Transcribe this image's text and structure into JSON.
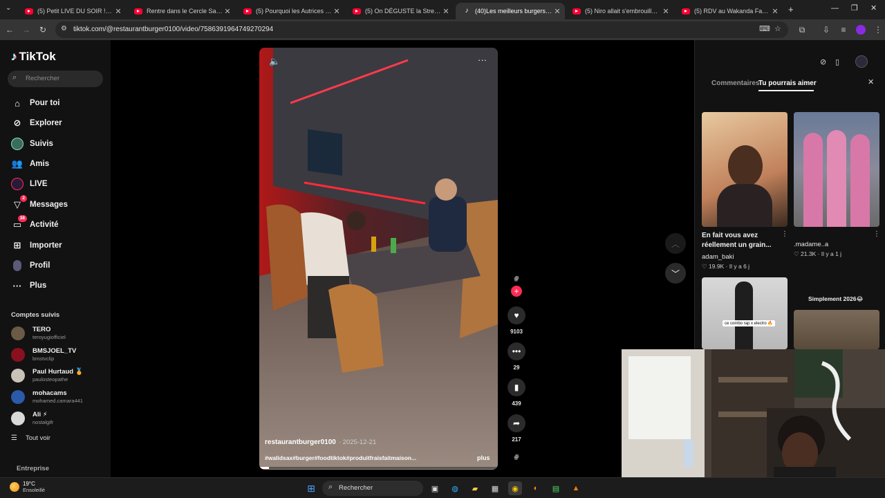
{
  "browser": {
    "tabs": [
      {
        "label": "(5) Petit LIVE DU SOIR ! - YouTu",
        "icon": "youtube-icon",
        "active": false
      },
      {
        "label": "Rentre dans le Cercle Saison 4 ;",
        "icon": "youtube-icon",
        "active": false
      },
      {
        "label": "(5) Pourquoi les Autrices gagne",
        "icon": "youtube-icon",
        "active": false
      },
      {
        "label": "(5) On DÉGUSTE la Street Food",
        "icon": "youtube-icon",
        "active": false
      },
      {
        "label": "(40)Les meilleurs burgers à Par",
        "icon": "tiktok-icon",
        "active": true
      },
      {
        "label": "(5) Niro allait s'embrouiller ave",
        "icon": "youtube-icon",
        "active": false
      },
      {
        "label": "(5) RDV au Wakanda Factory 😍",
        "icon": "youtube-icon",
        "active": false
      }
    ],
    "new_tab": "+",
    "url": "tiktok.com/@restaurantburger0100/video/7586391964749270294"
  },
  "tiktok": {
    "logo": "TikTok",
    "search_placeholder": "Rechercher",
    "nav": [
      {
        "label": "Pour toi",
        "icon": "home-icon"
      },
      {
        "label": "Explorer",
        "icon": "compass-icon"
      },
      {
        "label": "Suivis",
        "icon": "following-avatar-icon"
      },
      {
        "label": "Amis",
        "icon": "friends-icon"
      },
      {
        "label": "LIVE",
        "icon": "live-icon"
      },
      {
        "label": "Messages",
        "icon": "messages-icon",
        "badge": "2"
      },
      {
        "label": "Activité",
        "icon": "activity-icon",
        "badge": "38"
      },
      {
        "label": "Importer",
        "icon": "upload-icon"
      },
      {
        "label": "Profil",
        "icon": "profile-icon"
      },
      {
        "label": "Plus",
        "icon": "more-icon"
      }
    ],
    "following_title": "Comptes suivis",
    "following": [
      {
        "name": "TERO",
        "handle": "teroyugiofficiel",
        "color": "#6b5a45"
      },
      {
        "name": "BMSJOEL_TV",
        "handle": "bmstvclip",
        "color": "#8a1020"
      },
      {
        "name": "Paul Hurtaud 🏅",
        "handle": "paulosteopathe",
        "color": "#c9c2b8"
      },
      {
        "name": "mohacams",
        "handle": "mohamed.camara441",
        "color": "#2a5aa8"
      },
      {
        "name": "Ali ⚡",
        "handle": "nostalgifr",
        "color": "#d9d9d9"
      }
    ],
    "see_all": "Tout voir",
    "footer": "Entreprise",
    "video": {
      "author": "restaurantburger0100",
      "date": "· 2025-12-21",
      "tags": "#walidsax#burger#foodtiktok#produitfraisfaitmaison...",
      "more": "plus"
    },
    "actions": {
      "likes": "9103",
      "comments": "29",
      "saves": "439",
      "shares": "217"
    },
    "right_panel": {
      "tab_comments": "Commentaires",
      "tab_suggested": "Tu pourrais aimer",
      "videos": [
        {
          "caption": "En fait vous avez réellement un grain...",
          "author": "adam_baki",
          "likes": "19.9K",
          "age": "Il y a 6 j"
        },
        {
          "caption": "",
          "author": ".madame..a",
          "likes": "21.3K",
          "age": "Il y a 1 j"
        },
        {
          "caption": "",
          "overlay": "ce combo rap x electro 🔥",
          "author": "",
          "likes": "",
          "age": ""
        },
        {
          "caption": "Simplement 2026😂",
          "author": "",
          "likes": "",
          "age": ""
        }
      ]
    }
  },
  "taskbar": {
    "temp": "19°C",
    "weather": "Ensoleillé",
    "search": "Rechercher"
  }
}
